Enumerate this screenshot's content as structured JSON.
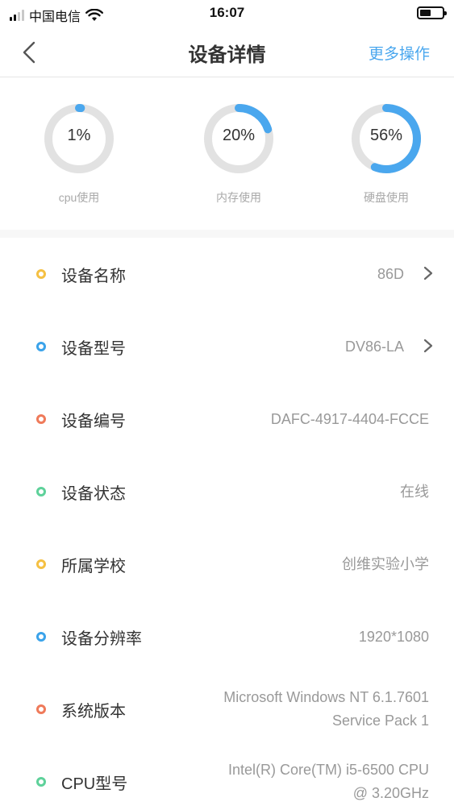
{
  "status_bar": {
    "carrier": "中国电信",
    "time": "16:07"
  },
  "nav": {
    "title": "设备详情",
    "more": "更多操作"
  },
  "gauges": [
    {
      "percent": 1,
      "text": "1%",
      "label": "cpu使用"
    },
    {
      "percent": 20,
      "text": "20%",
      "label": "内存使用"
    },
    {
      "percent": 56,
      "text": "56%",
      "label": "硬盘使用"
    }
  ],
  "colors": {
    "accent": "#4aa7ee",
    "gauge_track": "#e2e2e2",
    "gauge_arc": "#4aa7ee",
    "dot_yellow": "#f5c043",
    "dot_blue": "#3ba3ea",
    "dot_red": "#ef7a5a",
    "dot_green": "#5ed19a"
  },
  "rows": [
    {
      "label": "设备名称",
      "value": "86D",
      "dot": "yellow",
      "arrow": true
    },
    {
      "label": "设备型号",
      "value": "DV86-LA",
      "dot": "blue",
      "arrow": true
    },
    {
      "label": "设备编号",
      "value": "DAFC-4917-4404-FCCE",
      "dot": "red",
      "arrow": false
    },
    {
      "label": "设备状态",
      "value": "在线",
      "dot": "green",
      "arrow": false
    },
    {
      "label": "所属学校",
      "value": "创维实验小学",
      "dot": "yellow",
      "arrow": false
    },
    {
      "label": "设备分辨率",
      "value": "1920*1080",
      "dot": "blue",
      "arrow": false
    },
    {
      "label": "系统版本",
      "value": "Microsoft Windows NT 6.1.7601",
      "value_line2": "Service Pack 1",
      "dot": "red",
      "arrow": false
    },
    {
      "label": "CPU型号",
      "value": "Intel(R) Core(TM) i5-6500 CPU",
      "value_line2": "@ 3.20GHz",
      "dot": "green",
      "arrow": false
    }
  ]
}
